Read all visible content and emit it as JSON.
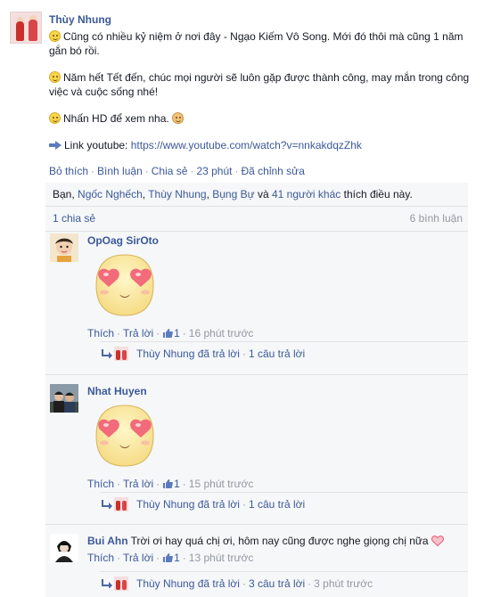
{
  "post": {
    "author": "Thùy Nhung",
    "line1": "Cũng có nhiều kỷ niệm ở nơi đây - Ngạo Kiếm Vô Song. Mới đó thôi mà cũng 1 năm gắn bó rồi.",
    "line2": "Năm hết Tết đến, chúc mọi người sẽ luôn gặp được thành công, may mắn trong công việc và cuộc sống nhé!",
    "line3": "Nhấn HD để xem nha.",
    "link_label": "Link youtube:",
    "link_url": "https://www.youtube.com/watch?v=nnkakdqzZhk"
  },
  "actions": {
    "unlike": "Bỏ thích",
    "comment": "Bình luận",
    "share": "Chia sẻ",
    "time": "23 phút",
    "edited": "Đã chỉnh sửa"
  },
  "likes": {
    "prefix": "Bạn, ",
    "name1": "Ngốc Nghếch",
    "name2": "Thùy Nhung",
    "name3": "Bụng Bự",
    "and": " và ",
    "others": "41 người khác",
    "suffix": " thích điều này."
  },
  "share_row": {
    "shares": "1 chia sẻ",
    "comments": "6 bình luận"
  },
  "comments": [
    {
      "name": "OpOag SirOto",
      "like": "Thích",
      "reply": "Trả lời",
      "like_count": "1",
      "time": "16 phút trước",
      "reply_author_text": "Thùy Nhung đã trả lời",
      "reply_count": "1 câu trả lời"
    },
    {
      "name": "Nhat Huyen",
      "like": "Thích",
      "reply": "Trả lời",
      "like_count": "1",
      "time": "15 phút trước",
      "reply_author_text": "Thùy Nhung đã trả lời",
      "reply_count": "1 câu trả lời"
    },
    {
      "name": "Bui Ahn",
      "text": "Trời ơi hay quá chị ơi, hôm nay cũng được nghe giọng chị nữa",
      "like": "Thích",
      "reply": "Trả lời",
      "like_count": "1",
      "time": "13 phút trước",
      "reply_author_text": "Thùy Nhung đã trả lời",
      "reply_count": "3 câu trả lời",
      "reply_time": "3 phút trước"
    }
  ],
  "colors": {
    "link": "#3b5998",
    "meta": "#9197a3",
    "ufi_bg": "#f6f7f9"
  },
  "icons": [
    "smile-icon",
    "palette-icon",
    "share-arrow-icon",
    "like-thumb-icon",
    "reply-arrow-icon",
    "heart-icon",
    "heart-eyes-sticker"
  ]
}
